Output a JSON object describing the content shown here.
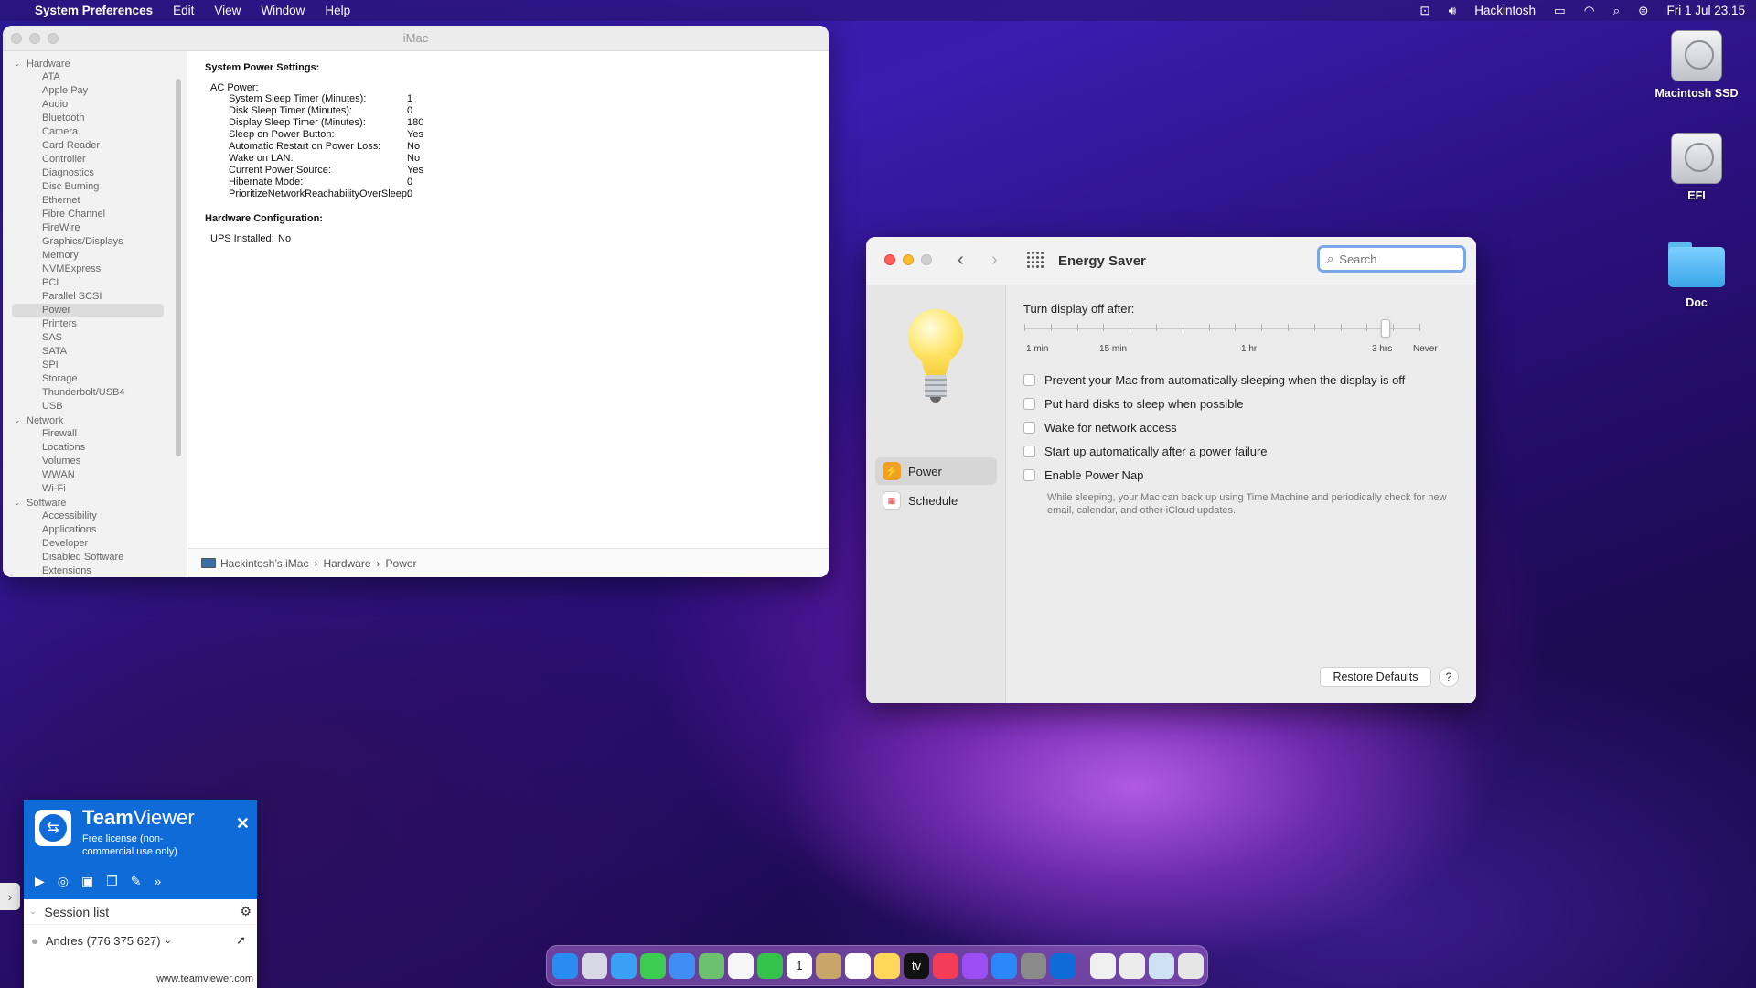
{
  "menubar": {
    "app": "System Preferences",
    "items": [
      "Edit",
      "View",
      "Window",
      "Help"
    ],
    "user": "Hackintosh",
    "datetime": "Fri 1 Jul  23.15"
  },
  "desktop": {
    "icons": [
      "Macintosh SSD",
      "EFI",
      "Doc"
    ]
  },
  "sysinfo": {
    "title": "iMac",
    "sidebar": [
      {
        "group": "Hardware",
        "items": [
          "ATA",
          "Apple Pay",
          "Audio",
          "Bluetooth",
          "Camera",
          "Card Reader",
          "Controller",
          "Diagnostics",
          "Disc Burning",
          "Ethernet",
          "Fibre Channel",
          "FireWire",
          "Graphics/Displays",
          "Memory",
          "NVMExpress",
          "PCI",
          "Parallel SCSI",
          "Power",
          "Printers",
          "SAS",
          "SATA",
          "SPI",
          "Storage",
          "Thunderbolt/USB4",
          "USB"
        ]
      },
      {
        "group": "Network",
        "items": [
          "Firewall",
          "Locations",
          "Volumes",
          "WWAN",
          "Wi-Fi"
        ]
      },
      {
        "group": "Software",
        "items": [
          "Accessibility",
          "Applications",
          "Developer",
          "Disabled Software",
          "Extensions"
        ]
      }
    ],
    "selected": "Power",
    "content": {
      "h1": "System Power Settings:",
      "ac_label": "AC Power:",
      "rows": [
        {
          "k": "System Sleep Timer (Minutes):",
          "v": "1"
        },
        {
          "k": "Disk Sleep Timer (Minutes):",
          "v": "0"
        },
        {
          "k": "Display Sleep Timer (Minutes):",
          "v": "180"
        },
        {
          "k": "Sleep on Power Button:",
          "v": "Yes"
        },
        {
          "k": "Automatic Restart on Power Loss:",
          "v": "No"
        },
        {
          "k": "Wake on LAN:",
          "v": "No"
        },
        {
          "k": "Current Power Source:",
          "v": "Yes"
        },
        {
          "k": "Hibernate Mode:",
          "v": "0"
        },
        {
          "k": "PrioritizeNetworkReachabilityOverSleep:",
          "v": "0"
        }
      ],
      "h2": "Hardware Configuration:",
      "ups_label": "UPS Installed:",
      "ups_value": "No"
    },
    "path": [
      "Hackintosh’s iMac",
      "Hardware",
      "Power"
    ]
  },
  "energy": {
    "title": "Energy Saver",
    "search_placeholder": "Search",
    "nav": [
      {
        "label": "Power"
      },
      {
        "label": "Schedule"
      }
    ],
    "slider_label": "Turn display off after:",
    "slider_value_fraction": 0.915,
    "ticks": [
      "1 min",
      "15 min",
      "1 hr",
      "3 hrs",
      "Never"
    ],
    "checkboxes": [
      "Prevent your Mac from automatically sleeping when the display is off",
      "Put hard disks to sleep when possible",
      "Wake for network access",
      "Start up automatically after a power failure",
      "Enable Power Nap"
    ],
    "powernap_desc": "While sleeping, your Mac can back up using Time Machine and periodically check for new email, calendar, and other iCloud updates.",
    "restore": "Restore Defaults",
    "help": "?"
  },
  "teamviewer": {
    "brand_bold": "Team",
    "brand_light": "Viewer",
    "license": "Free license (non-commercial use only)",
    "session_list": "Session list",
    "partner": "Andres (776 375 627)",
    "url": "www.teamviewer.com"
  },
  "dock": {
    "apps": [
      "finder-icon",
      "launchpad-icon",
      "safari-icon",
      "messages-icon",
      "mail-icon",
      "maps-icon",
      "photos-icon",
      "facetime-icon",
      "calendar-icon",
      "contacts-icon",
      "reminders-icon",
      "notes-icon",
      "tv-icon",
      "music-icon",
      "podcasts-icon",
      "appstore-icon",
      "sysprefs-icon",
      "teamviewer-icon",
      "preview-icon",
      "document-icon",
      "folder-icon",
      "trash-icon"
    ],
    "calendar_day": "1",
    "tv_label": "tv"
  }
}
